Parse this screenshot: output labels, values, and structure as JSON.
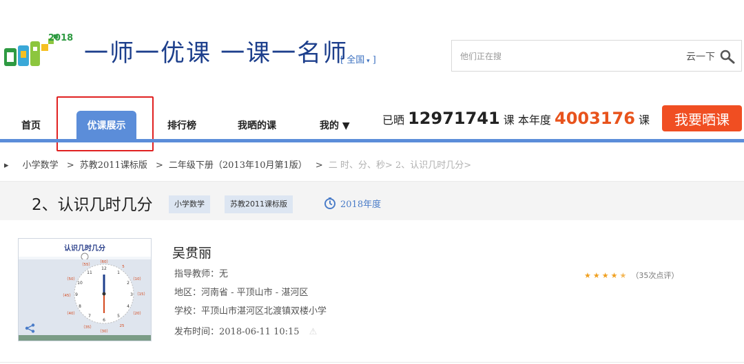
{
  "header": {
    "logo_year": "2018",
    "slogan": "一师一优课 一课一名师",
    "region_label": "全国",
    "search": {
      "placeholder": "他们正在搜",
      "button_label": "云一下"
    }
  },
  "nav": {
    "items": [
      "首页",
      "优课展示",
      "排行榜",
      "我晒的课",
      "我的 ▼"
    ],
    "active_index": 1
  },
  "stats": {
    "prefix": "已晒",
    "total": "12971741",
    "unit1": "课",
    "year_label": "本年度",
    "year_total": "4003176",
    "unit2": "课"
  },
  "share_button": "我要晒课",
  "breadcrumb": [
    "小学数学",
    "苏教2011课标版",
    "二年级下册（2013年10月第1版）",
    "二 时、分、秒",
    "2、认识几时几分"
  ],
  "lesson": {
    "title": "2、认识几时几分",
    "tags": [
      "小学数学",
      "苏教2011课标版"
    ],
    "year": "2018年度"
  },
  "card": {
    "thumbnail_title": "认识几时几分",
    "teacher": "吴贯丽",
    "advisor": "指导教师：无",
    "region": "地区：河南省 - 平顶山市 - 湛河区",
    "school": "学校：平顶山市湛河区北渡镇双楼小学",
    "published": "发布时间：2018-06-11 10:15",
    "rating_stars": 4.5,
    "reviews": "（35次点评）"
  },
  "colors": {
    "nav_blue": "#5b8dd9",
    "accent_orange": "#e8531c",
    "share_red": "#f04e22",
    "highlight_red": "#e02020"
  }
}
